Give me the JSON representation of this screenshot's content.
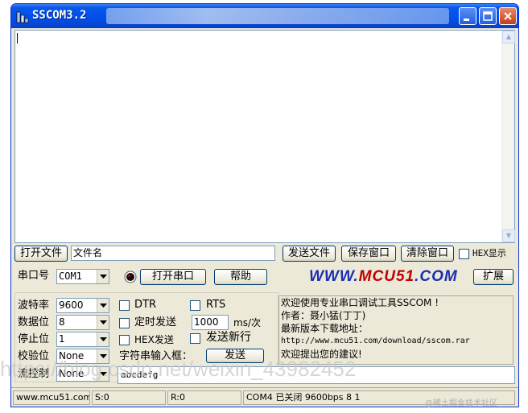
{
  "window": {
    "title": "SSCOM3.2"
  },
  "toolbar1": {
    "open_file": "打开文件",
    "file_name": "文件名",
    "send_file": "发送文件",
    "save_window": "保存窗口",
    "clear_window": "清除窗口",
    "hex_display": "HEX显示"
  },
  "toolbar2": {
    "port_label": "串口号",
    "port_value": "COM1",
    "open_port": "打开串口",
    "help": "帮助",
    "logo_a": "WWW.",
    "logo_b": "MCU51",
    "logo_c": ".COM",
    "expand": "扩展"
  },
  "settings": {
    "baud_label": "波特率",
    "baud_value": "9600",
    "data_label": "数据位",
    "data_value": "8",
    "stop_label": "停止位",
    "stop_value": "1",
    "parity_label": "校验位",
    "parity_value": "None",
    "flow_label": "流控制",
    "flow_value": "None"
  },
  "options": {
    "dtr": "DTR",
    "rts": "RTS",
    "timed_send": "定时发送",
    "interval_value": "1000",
    "interval_unit": "ms/次",
    "hex_send": "HEX发送",
    "send_newline": "发送新行",
    "input_label": "字符串输入框：",
    "send": "发送"
  },
  "info": {
    "line1": "欢迎使用专业串口调试工具SSCOM !",
    "line2": "作者：聂小猛(丁丁)",
    "line3": "最新版本下载地址：",
    "line4": "http://www.mcu51.com/download/sscom.rar",
    "line5": "欢迎提出您的建议!"
  },
  "send_text": "abcdefg",
  "status": {
    "site": "www.mcu51.com",
    "s": "S:0",
    "r": "R:0",
    "port_state": "COM4 已关闭 9600bps 8 1"
  },
  "watermark": {
    "url": "https://blog.csdn.net/weixin_43982452",
    "credit": "@稀土掘金技术社区"
  },
  "colors": {
    "titlebar": "#0050ee",
    "logo_blue": "#1a2fb0",
    "logo_red": "#c00000",
    "face": "#ece9d8"
  }
}
